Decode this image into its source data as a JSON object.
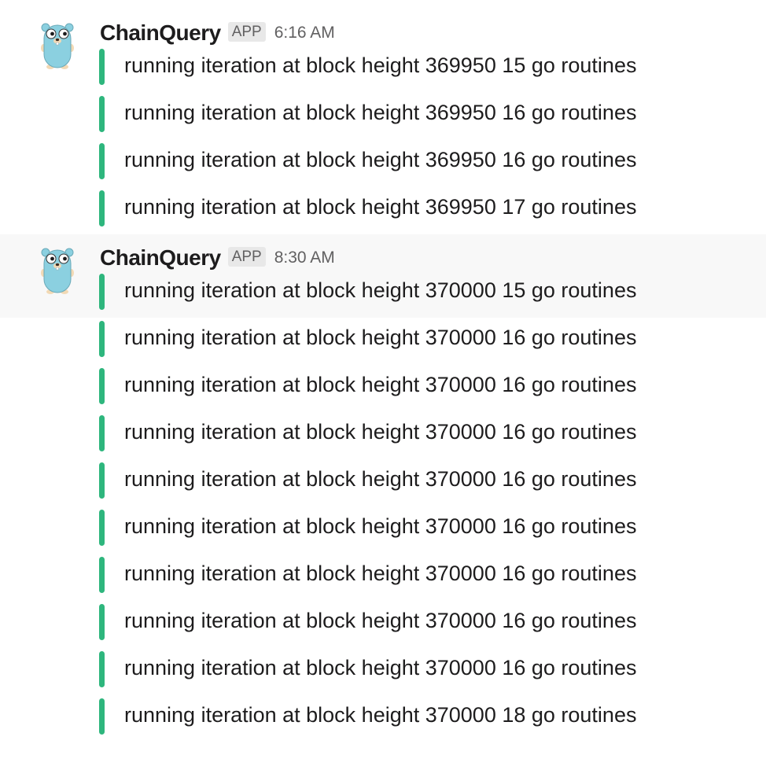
{
  "colors": {
    "attachment_bar": "#2eb67d",
    "hover_background": "#f8f8f8",
    "badge_background": "#e8e8e8",
    "muted_text": "#616061"
  },
  "messages": [
    {
      "avatar_icon": "gopher-avatar-icon",
      "sender": "ChainQuery",
      "badge": "APP",
      "time": "6:16 AM",
      "lines": [
        "running iteration at block height 369950 15 go routines",
        "running iteration at block height 369950 16 go routines",
        "running iteration at block height 369950 16 go routines",
        "running iteration at block height 369950 17 go routines"
      ]
    },
    {
      "avatar_icon": "gopher-avatar-icon",
      "sender": "ChainQuery",
      "badge": "APP",
      "time": "8:30 AM",
      "lines": [
        "running iteration at block height 370000 15 go routines",
        "running iteration at block height 370000 16 go routines",
        "running iteration at block height 370000 16 go routines",
        "running iteration at block height 370000 16 go routines",
        "running iteration at block height 370000 16 go routines",
        "running iteration at block height 370000 16 go routines",
        "running iteration at block height 370000 16 go routines",
        "running iteration at block height 370000 16 go routines",
        "running iteration at block height 370000 16 go routines",
        "running iteration at block height 370000 18 go routines"
      ]
    }
  ]
}
